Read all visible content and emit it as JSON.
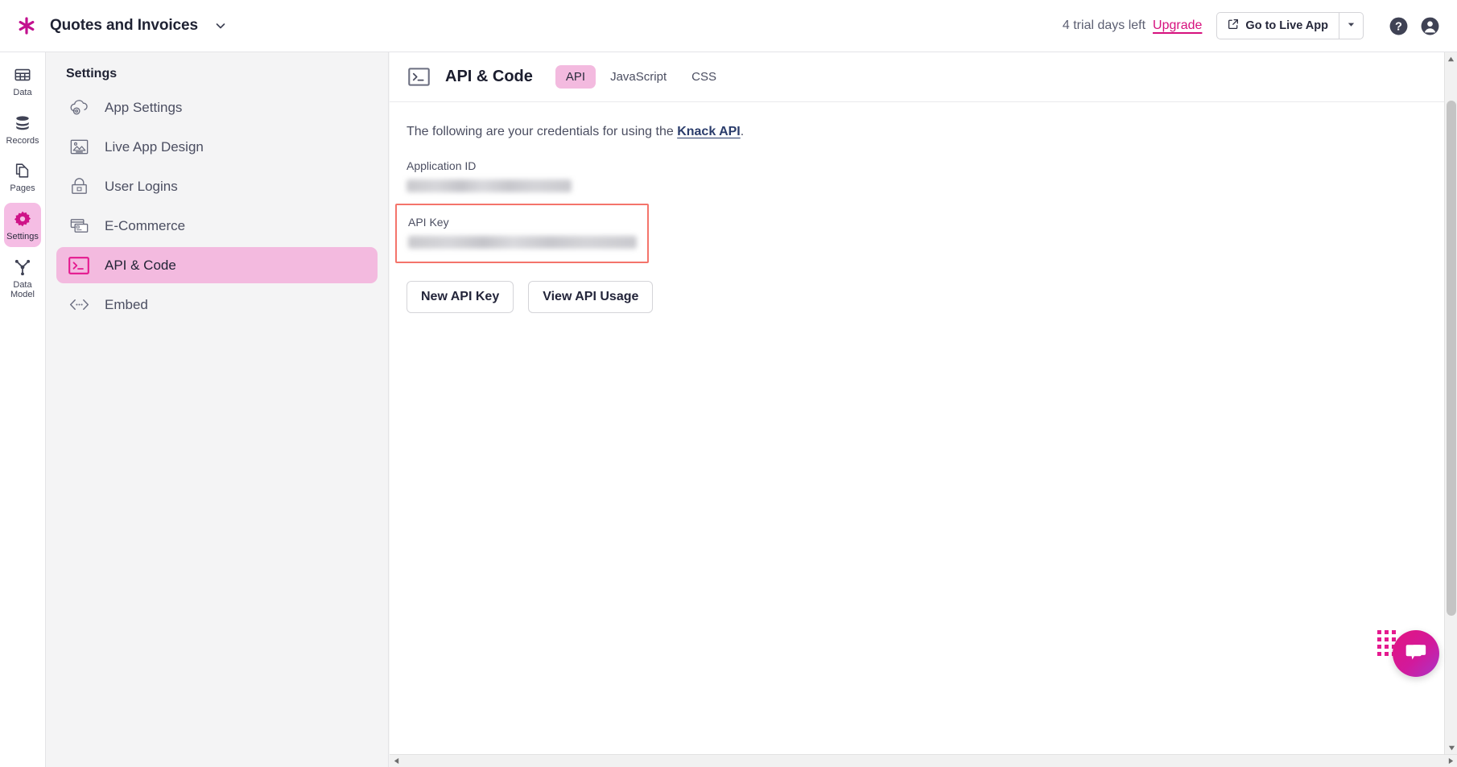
{
  "header": {
    "brand_icon": "asterisk-logo-icon",
    "app_title": "Quotes and Invoices",
    "app_switcher_icon": "chevron-down-icon",
    "trial_text": "4 trial days left",
    "upgrade_label": "Upgrade",
    "live_app_label": "Go to Live App",
    "live_app_icon": "external-link-icon",
    "live_app_caret_icon": "caret-down-icon",
    "help_icon": "help-circle-icon",
    "account_icon": "user-account-icon",
    "accent_color": "#d6117e"
  },
  "rail": {
    "items": [
      {
        "label": "Data",
        "icon": "table-icon",
        "active": false
      },
      {
        "label": "Records",
        "icon": "database-icon",
        "active": false
      },
      {
        "label": "Pages",
        "icon": "pages-icon",
        "active": false
      },
      {
        "label": "Settings",
        "icon": "gear-icon",
        "active": true
      },
      {
        "label": "Data Model",
        "icon": "data-model-icon",
        "active": false
      }
    ],
    "active_bg": "#f5bde4"
  },
  "settings_sidebar": {
    "title": "Settings",
    "items": [
      {
        "label": "App Settings",
        "icon": "cloud-gear-icon",
        "active": false
      },
      {
        "label": "Live App Design",
        "icon": "image-frame-icon",
        "active": false
      },
      {
        "label": "User Logins",
        "icon": "lock-icon",
        "active": false
      },
      {
        "label": "E-Commerce",
        "icon": "credit-card-icon",
        "active": false
      },
      {
        "label": "API & Code",
        "icon": "terminal-icon",
        "active": true
      },
      {
        "label": "Embed",
        "icon": "code-brackets-icon",
        "active": false
      }
    ],
    "active_bg": "#f3badf"
  },
  "main": {
    "icon": "terminal-icon",
    "title": "API & Code",
    "tabs": [
      {
        "label": "API",
        "active": true
      },
      {
        "label": "JavaScript",
        "active": false
      },
      {
        "label": "CSS",
        "active": false
      }
    ],
    "lede_prefix": "The following are your credentials for using the ",
    "lede_link": "Knack API",
    "lede_suffix": ".",
    "application_id_label": "Application ID",
    "application_id_value": "",
    "api_key_label": "API Key",
    "api_key_value": "",
    "highlight_color": "#f4746b",
    "buttons": [
      {
        "label": "New API Key"
      },
      {
        "label": "View API Usage"
      }
    ]
  },
  "scrollbars": {
    "v_up_icon": "scroll-up-arrow-icon",
    "v_down_icon": "scroll-down-arrow-icon",
    "h_left_icon": "scroll-left-arrow-icon",
    "h_right_icon": "scroll-right-arrow-icon"
  },
  "chat": {
    "drag_handle_icon": "drag-grip-icon",
    "chat_icon": "chat-bubbles-icon"
  }
}
